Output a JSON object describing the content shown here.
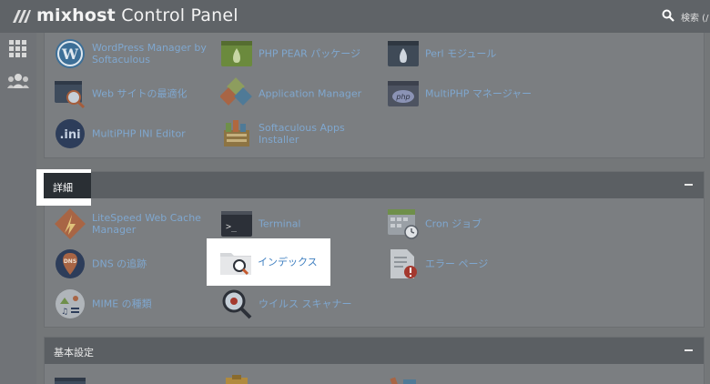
{
  "header": {
    "brand_bold": "mixhost",
    "brand_rest": "Control Panel",
    "search_label": "検索 (/"
  },
  "rail": {
    "apps_icon": "grid-icon",
    "users_icon": "users-icon"
  },
  "section_top": {
    "items": [
      {
        "label": "WordPress Manager by Softaculous",
        "icon": "wordpress-icon"
      },
      {
        "label": "PHP PEAR パッケージ",
        "icon": "pear-icon"
      },
      {
        "label": "Perl モジュール",
        "icon": "onion-icon"
      },
      {
        "label": "Web サイトの最適化",
        "icon": "optimize-icon"
      },
      {
        "label": "Application Manager",
        "icon": "cubes-icon"
      },
      {
        "label": "MultiPHP マネージャー",
        "icon": "php-icon"
      },
      {
        "label": "MultiPHP INI Editor",
        "icon": "ini-icon"
      },
      {
        "label": "Softaculous Apps Installer",
        "icon": "softaculous-icon"
      }
    ]
  },
  "section_advanced": {
    "title": "詳細",
    "items": [
      {
        "label": "LiteSpeed Web Cache Manager",
        "icon": "litespeed-icon"
      },
      {
        "label": "Terminal",
        "icon": "terminal-icon"
      },
      {
        "label": "Cron ジョブ",
        "icon": "calendar-clock-icon"
      },
      {
        "label": "DNS の追跡",
        "icon": "dns-pin-icon"
      },
      {
        "label": "インデックス",
        "icon": "folder-search-icon"
      },
      {
        "label": "エラー ページ",
        "icon": "error-page-icon"
      },
      {
        "label": "MIME の種類",
        "icon": "mime-icon"
      },
      {
        "label": "ウイルス スキャナー",
        "icon": "virus-scan-icon"
      }
    ]
  },
  "section_basic": {
    "title": "基本設定"
  },
  "colors": {
    "link": "#7fa7cf",
    "header_bg": "#5b5f63",
    "highlight": "#ffffff"
  }
}
